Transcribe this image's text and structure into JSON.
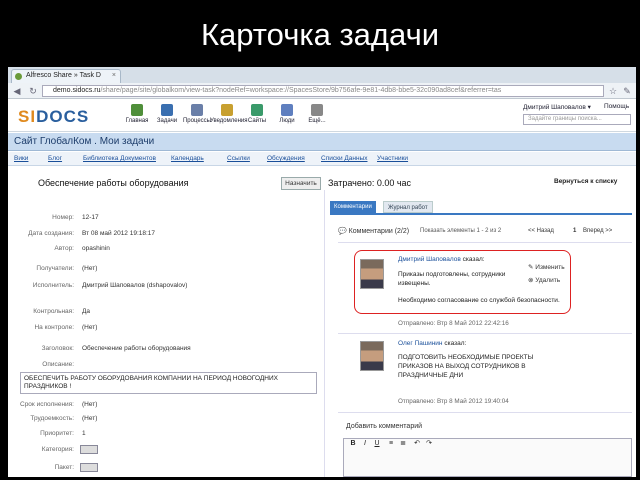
{
  "slide": {
    "title": "Карточка задачи"
  },
  "browser": {
    "tab_title": "Alfresco Share » Task D",
    "tab_close": "×",
    "url_host": "demo.sidocs.ru",
    "url_rest": "/share/page/site/globalkom/view-task?nodeRef=workspace://SpacesStore/9b756afe-9e81-4db8-bbe5-32c090ad8cef&referrer=tas"
  },
  "app": {
    "logo_a": "SI",
    "logo_b": "DOCS",
    "nav": [
      {
        "label": "Главная",
        "color": "#4f8f3a"
      },
      {
        "label": "Задачи",
        "color": "#3a6fb0"
      },
      {
        "label": "Процессы",
        "color": "#6a7fa8"
      },
      {
        "label": "Уведомления",
        "color": "#c8a030"
      },
      {
        "label": "Сайты",
        "color": "#3a9a6a"
      },
      {
        "label": "Люди",
        "color": "#5f7fbf"
      },
      {
        "label": "Ещё...",
        "color": "#888888"
      }
    ],
    "user": "Дмитрий Шаповалов ▾",
    "help": "Помощь",
    "search_placeholder": "Задайте границы поиска..."
  },
  "site": {
    "title": "Сайт ГлобалКом . Мои задачи",
    "prefix": "Сайт",
    "nav": [
      "Вики",
      "Блог",
      "Библиотека Документов",
      "Календарь",
      "Ссылки",
      "Обсуждения",
      "Списки Данных",
      "Участники"
    ]
  },
  "task": {
    "title": "Обеспечение работы оборудования",
    "button": "Назначить",
    "fields": [
      {
        "label": "Номер:",
        "value": "12-17"
      },
      {
        "label": "Дата создания:",
        "value": "Вт 08 май 2012 19:18:17"
      },
      {
        "label": "Автор:",
        "value": "opashinin"
      },
      {
        "label": "Получатели:",
        "value": "(Нет)"
      },
      {
        "label": "Исполнитель:",
        "value": "Дмитрий Шаповалов (dshapovalov)"
      },
      {
        "label": "Контрольная:",
        "value": "Да"
      },
      {
        "label": "На контроле:",
        "value": "(Нет)"
      },
      {
        "label": "Заголовок:",
        "value": "Обеспечение работы оборудования"
      },
      {
        "label": "Описание:",
        "value": ""
      }
    ],
    "description": "ОБЕСПЕЧИТЬ РАБОТУ ОБОРУДОВАНИЯ КОМПАНИИ НА ПЕРИОД НОВОГОДНИХ ПРАЗДНИКОВ !",
    "fields2": [
      {
        "label": "Срок исполнения:",
        "value": "(Нет)"
      },
      {
        "label": "Трудоемкость:",
        "value": "(Нет)"
      },
      {
        "label": "Приоритет:",
        "value": "1"
      },
      {
        "label": "Категория:",
        "value": ""
      },
      {
        "label": "Пакет:",
        "value": ""
      }
    ]
  },
  "right": {
    "spent": "Затрачено: 0.00 час",
    "back": "Вернуться к списку",
    "tabs": [
      "Комментарии",
      "Журнал работ"
    ],
    "comments_head": "Комментарии (2/2)",
    "shown": "Показать элементы 1 - 2 из 2",
    "prev": "<< Назад",
    "page": "1",
    "next": "Вперед >>",
    "comments": [
      {
        "name": "Дмитрий Шаповалов",
        "said": "сказал:",
        "text": "Приказы подготовлены, сотрудники извещены.",
        "text2": "Необходимо согласование со службой безопасности.",
        "sent": "Отправлено: Втр 8 Май 2012 22:42:16",
        "edit": "Изменить",
        "del": "Удалить"
      },
      {
        "name": "Олег Пашинин",
        "said": "сказал:",
        "text": "ПОДГОТОВИТЬ НЕОБХОДИМЫЕ ПРОЕКТЫ ПРИКАЗОВ НА ВЫХОД СОТРУДНИКОВ В ПРАЗДНИЧНЫЕ ДНИ",
        "sent": "Отправлено: Втр 8 Май 2012 19:40:04"
      }
    ],
    "add_comment": "Добавить комментарий"
  }
}
